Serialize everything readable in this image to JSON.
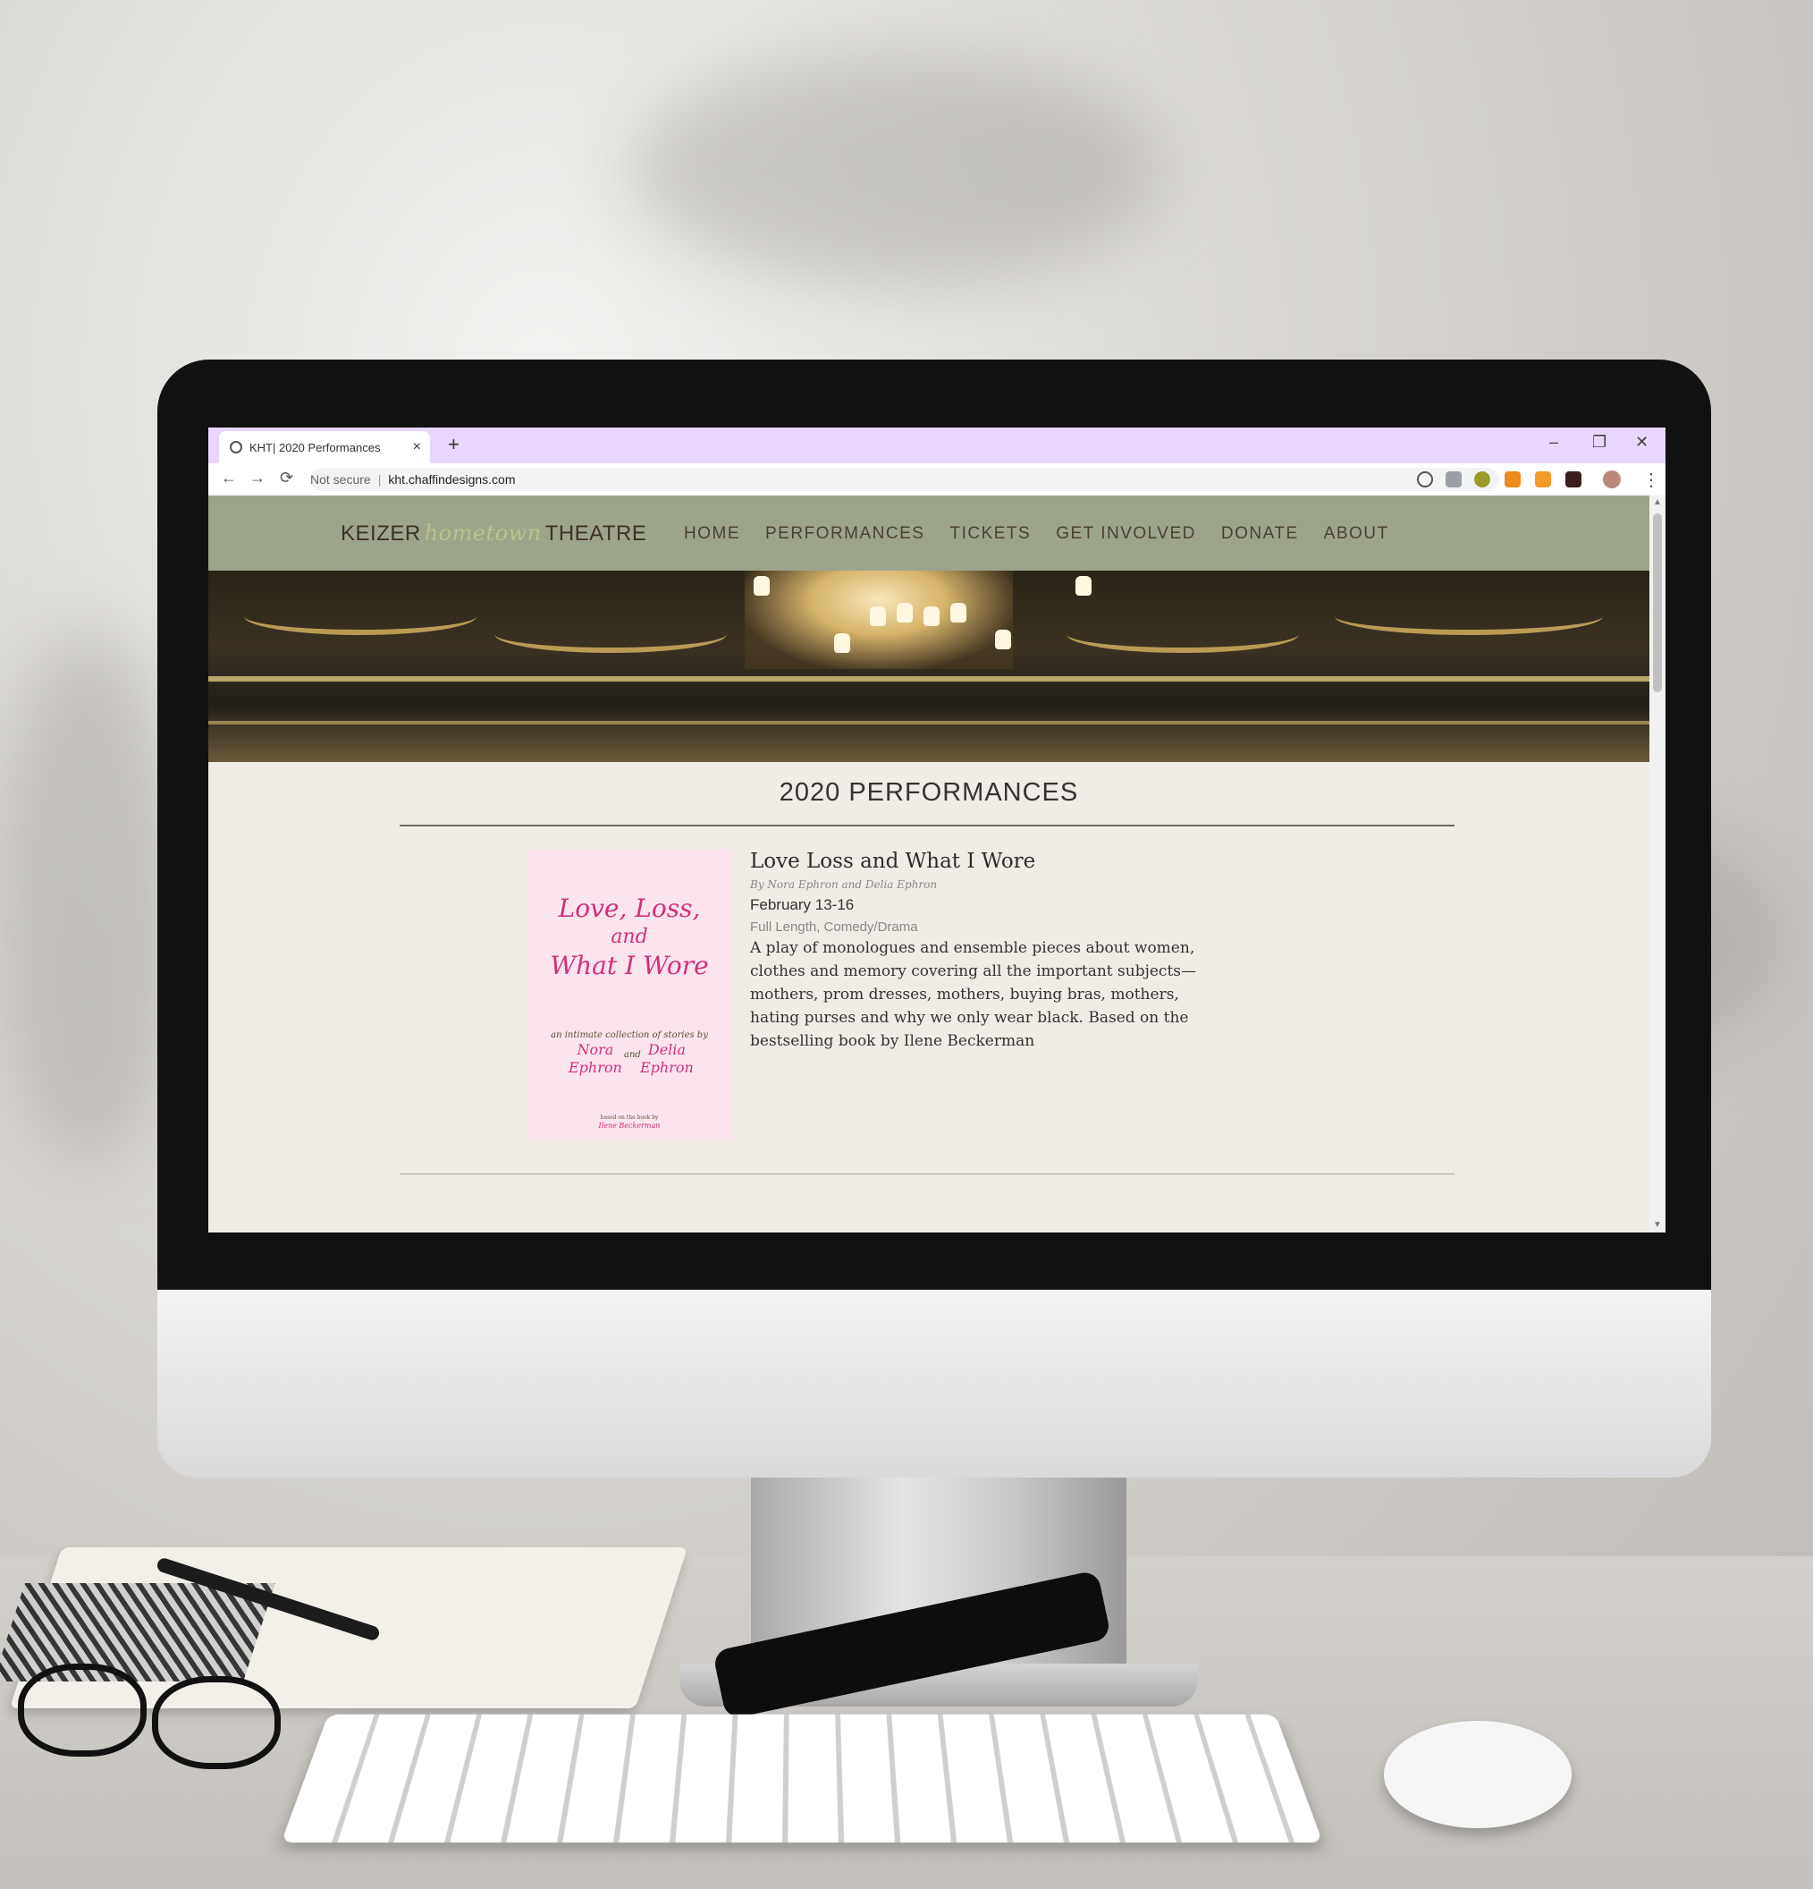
{
  "browser": {
    "tab_title": "KHT| 2020 Performances",
    "tab_close": "×",
    "new_tab": "+",
    "window_controls": [
      "–",
      "❐",
      "✕"
    ],
    "nav_buttons": [
      "←",
      "→",
      "⟳"
    ],
    "security_label": "Not secure",
    "url": "kht.chaffindesigns.com",
    "star": "☆",
    "menu": "⋮"
  },
  "site": {
    "logo_left": "KEIZER",
    "logo_script": "hometown",
    "logo_right": "THEATRE",
    "nav": [
      "HOME",
      "PERFORMANCES",
      "TICKETS",
      "GET INVOLVED",
      "DONATE",
      "ABOUT"
    ],
    "page_title": "2020 PERFORMANCES",
    "show": {
      "title": "Love Loss and What I Wore",
      "byline": "By Nora Ephron and Delia Ephron",
      "dates": "February 13-16",
      "genre": "Full Length, Comedy/Drama",
      "description": "A play of monologues and ensemble pieces about women, clothes and memory covering all the important subjects—mothers, prom dresses, mothers, buying bras, mothers, hating purses and why we only wear black. Based on the bestselling book by Ilene Beckerman",
      "poster": {
        "title_line1": "Love, Loss,",
        "title_line2": "and",
        "title_line3": "What I Wore",
        "subtitle": "an intimate collection of stories by",
        "author1_first": "Nora",
        "author1_last": "Ephron",
        "and": "and",
        "author2_first": "Delia",
        "author2_last": "Ephron",
        "credit_small": "based on the book by",
        "credit_name": "Ilene Beckerman"
      }
    }
  },
  "colors": {
    "tab_strip": "#e9d6ff",
    "header_bg": "#9da48c",
    "page_bg": "#f1ece6",
    "poster_bg": "#fbe4ee",
    "poster_text": "#d1307d"
  }
}
